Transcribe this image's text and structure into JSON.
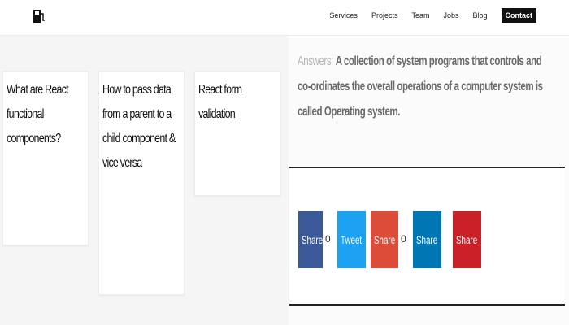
{
  "nav": {
    "logo": "fuel-pump-icon",
    "links": [
      "Services",
      "Projects",
      "Team",
      "Jobs",
      "Blog"
    ],
    "contact": "Contact"
  },
  "cards": [
    {
      "title": "What are React functional components?"
    },
    {
      "title": "How to pass data from a parent to a child component & vice versa"
    },
    {
      "title": "React form validation"
    }
  ],
  "answer": {
    "label": "Answers:",
    "text": "A collection of system programs that controls and co-ordinates the overall operations of a computer system is called Operating system."
  },
  "share": {
    "facebook": {
      "label": "Share",
      "count": "0",
      "color": "#3b5998",
      "icon": "facebook-icon"
    },
    "twitter": {
      "label": "Tweet",
      "color": "#1da1f2",
      "icon": "twitter-icon"
    },
    "googleplus": {
      "label": "Share",
      "count": "0",
      "color": "#dd4b39",
      "icon": "google-plus-icon"
    },
    "linkedin": {
      "label": "Share",
      "color": "#0077b5",
      "icon": "linkedin-icon"
    },
    "pinterest": {
      "label": "Share",
      "color": "#cb2027",
      "icon": "pinterest-icon"
    }
  }
}
